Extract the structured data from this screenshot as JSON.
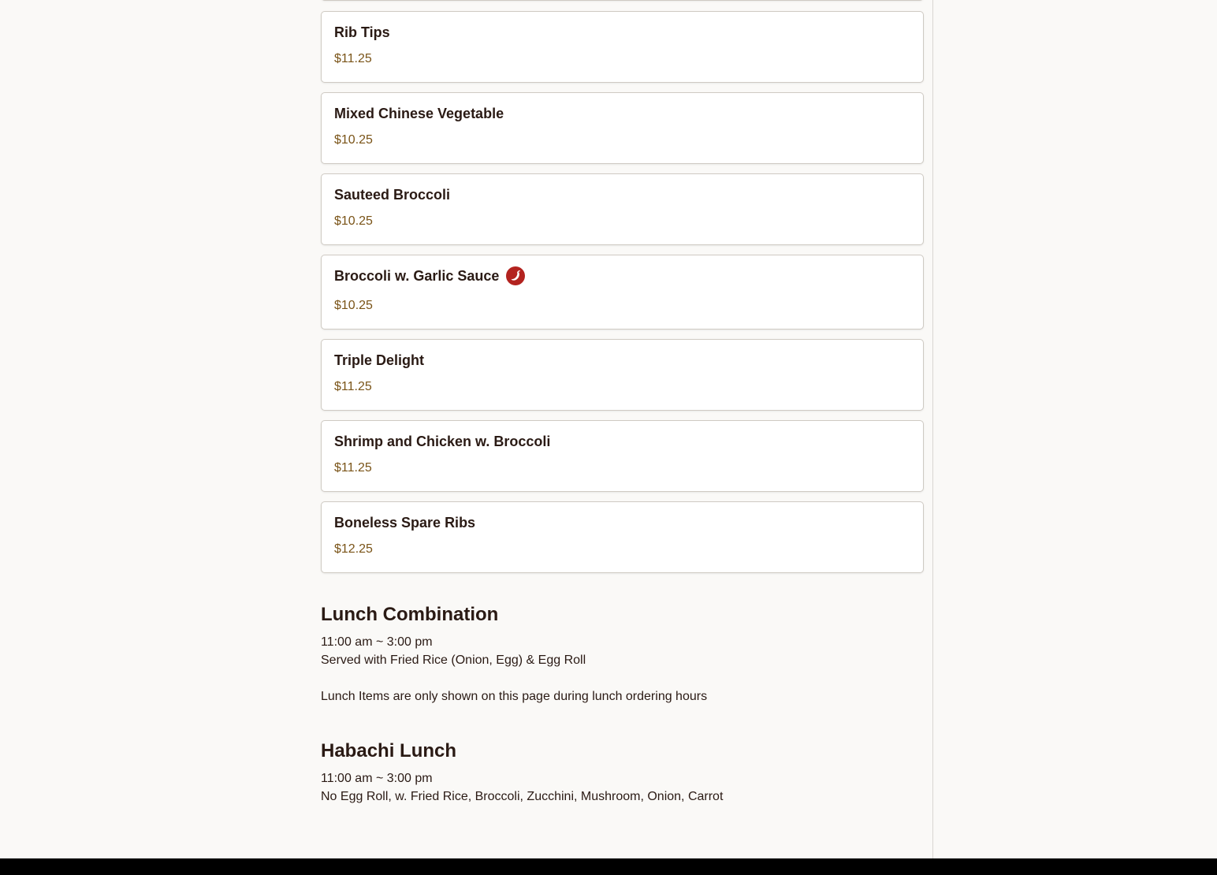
{
  "menu_items": [
    {
      "name": "Rib Tips",
      "price": "$11.25",
      "spicy": false
    },
    {
      "name": "Mixed Chinese Vegetable",
      "price": "$10.25",
      "spicy": false
    },
    {
      "name": "Sauteed Broccoli",
      "price": "$10.25",
      "spicy": false
    },
    {
      "name": "Broccoli w. Garlic Sauce",
      "price": "$10.25",
      "spicy": true,
      "spicy_icon": "chili-pepper-icon"
    },
    {
      "name": "Triple Delight",
      "price": "$11.25",
      "spicy": false
    },
    {
      "name": "Shrimp and Chicken w. Broccoli",
      "price": "$11.25",
      "spicy": false
    },
    {
      "name": "Boneless Spare Ribs",
      "price": "$12.25",
      "spicy": false
    }
  ],
  "sections": {
    "lunch_combination": {
      "title": "Lunch Combination",
      "hours": "11:00 am ~ 3:00 pm",
      "description": "Served with Fried Rice (Onion, Egg) & Egg Roll",
      "note": "Lunch Items are only shown on this page during lunch ordering hours"
    },
    "habachi_lunch": {
      "title": "Habachi Lunch",
      "hours": "11:00 am ~ 3:00 pm",
      "description": "No Egg Roll, w. Fried Rice, Broccoli, Zucchini, Mushroom, Onion, Carrot"
    }
  },
  "colors": {
    "page_background": "#faf9f7",
    "card_background": "#ffffff",
    "card_border": "#cfcac3",
    "text": "#2a1a14",
    "price": "#7a5418",
    "spicy_badge": "#b3231f",
    "footer": "#000000"
  }
}
